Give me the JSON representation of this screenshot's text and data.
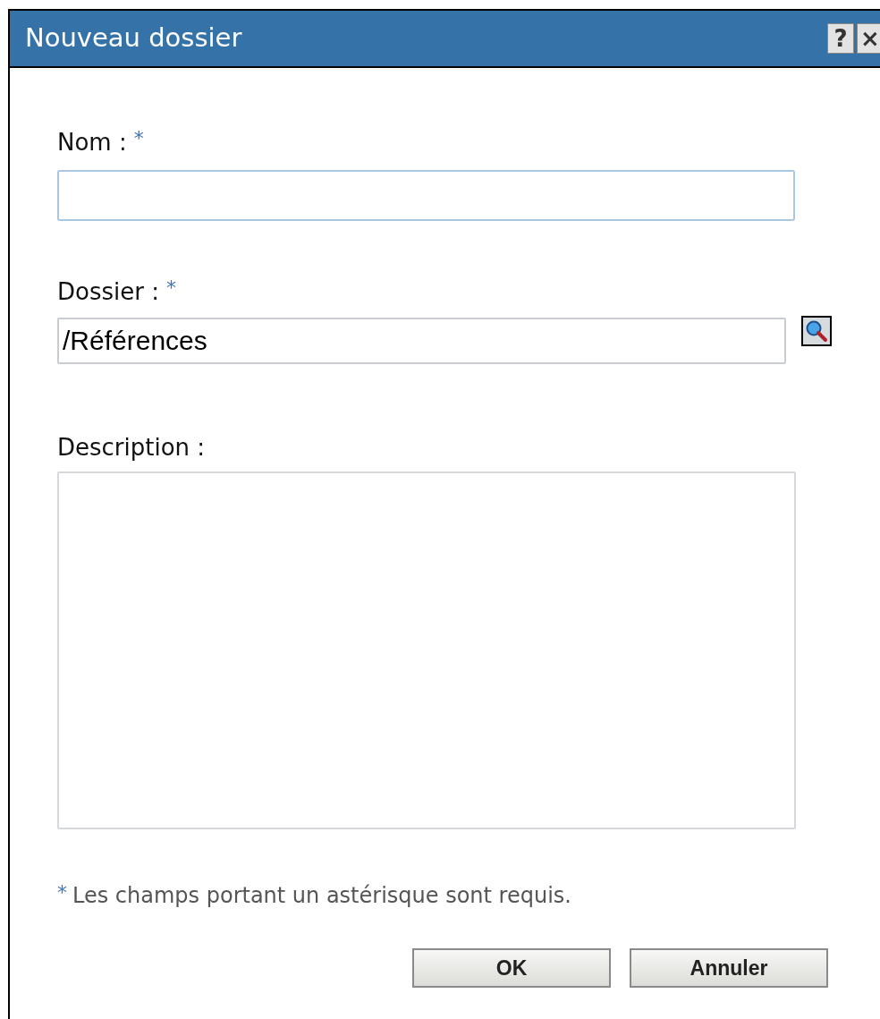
{
  "window": {
    "title": "Nouveau dossier",
    "buttons": [
      "?",
      "×"
    ]
  },
  "fields": [
    {
      "kind": "text",
      "label": "Nom :",
      "required_mark": "*"
    },
    {
      "kind": "lookup",
      "label": "Dossier :",
      "required_mark": "*",
      "value": "/Références"
    },
    {
      "kind": "textarea",
      "label": "Description :"
    }
  ],
  "footnote": {
    "mark": "*",
    "text": "Les champs portant un astérisque sont requis."
  },
  "buttons": [
    "OK",
    "Annuler"
  ]
}
